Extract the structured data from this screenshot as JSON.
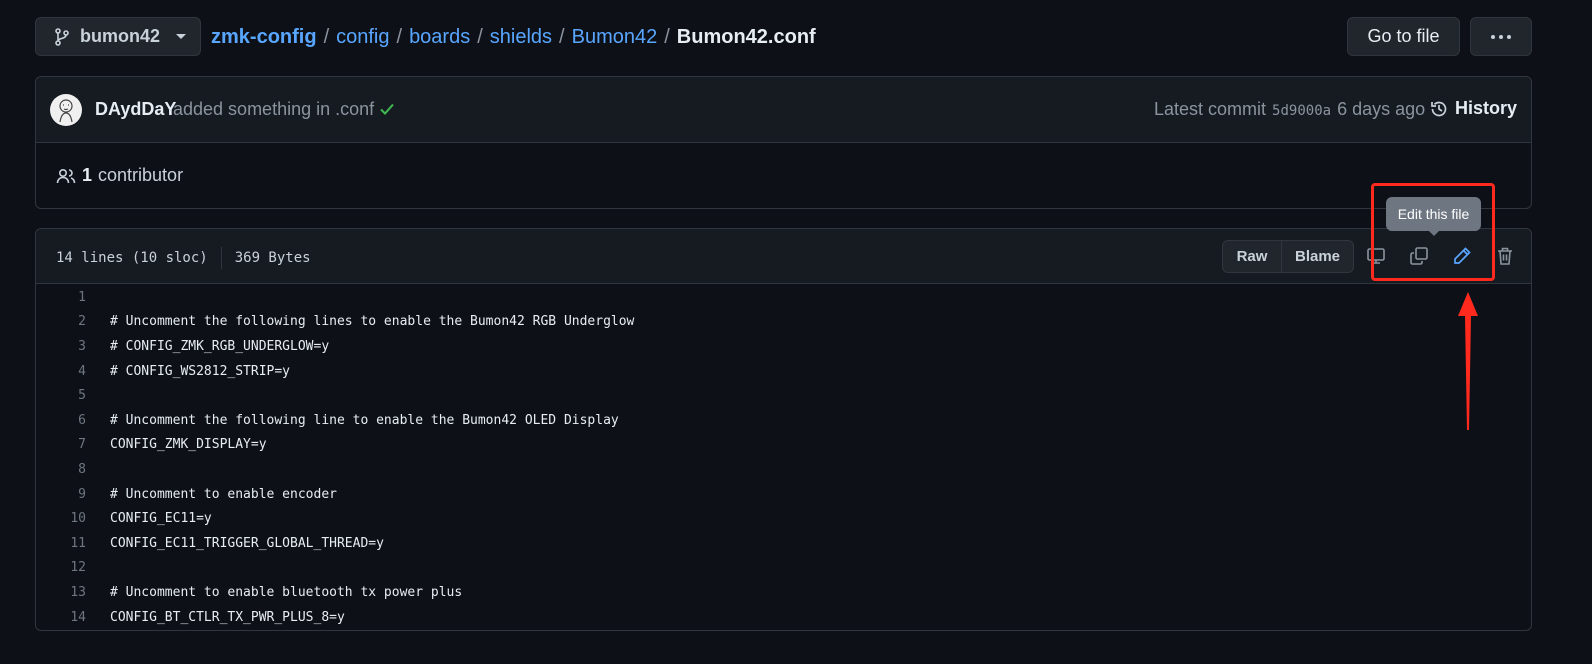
{
  "branch": {
    "name": "bumon42",
    "icon": "git-branch-icon"
  },
  "breadcrumb": [
    {
      "label": "zmk-config"
    },
    {
      "label": "config"
    },
    {
      "label": "boards"
    },
    {
      "label": "shields"
    },
    {
      "label": "Bumon42"
    }
  ],
  "breadcrumb_separator": "/",
  "file_name": "Bumon42.conf",
  "header_buttons": {
    "go_to_file": "Go to file"
  },
  "commit": {
    "author": "DAydDaY",
    "message": "added something in .conf",
    "status": "success",
    "latest_label": "Latest commit",
    "sha": "5d9000a",
    "time": "6 days ago",
    "history_label": "History"
  },
  "contributors": {
    "count": "1",
    "label": "contributor"
  },
  "file_info": {
    "lines": "14 lines (10 sloc)",
    "size": "369 Bytes"
  },
  "file_actions": {
    "raw": "Raw",
    "blame": "Blame"
  },
  "tooltip": "Edit this file",
  "annotation": {
    "highlight_color": "#ff2a1d"
  },
  "colors": {
    "background": "#0d1117",
    "link": "#58a6ff",
    "success": "#3fb950"
  },
  "code_lines": [
    {
      "n": "1",
      "text": ""
    },
    {
      "n": "2",
      "text": "# Uncomment the following lines to enable the Bumon42 RGB Underglow"
    },
    {
      "n": "3",
      "text": "# CONFIG_ZMK_RGB_UNDERGLOW=y"
    },
    {
      "n": "4",
      "text": "# CONFIG_WS2812_STRIP=y"
    },
    {
      "n": "5",
      "text": ""
    },
    {
      "n": "6",
      "text": "# Uncomment the following line to enable the Bumon42 OLED Display"
    },
    {
      "n": "7",
      "text": "CONFIG_ZMK_DISPLAY=y"
    },
    {
      "n": "8",
      "text": ""
    },
    {
      "n": "9",
      "text": "# Uncomment to enable encoder"
    },
    {
      "n": "10",
      "text": "CONFIG_EC11=y"
    },
    {
      "n": "11",
      "text": "CONFIG_EC11_TRIGGER_GLOBAL_THREAD=y"
    },
    {
      "n": "12",
      "text": ""
    },
    {
      "n": "13",
      "text": "# Uncomment to enable bluetooth tx power plus"
    },
    {
      "n": "14",
      "text": "CONFIG_BT_CTLR_TX_PWR_PLUS_8=y"
    }
  ]
}
